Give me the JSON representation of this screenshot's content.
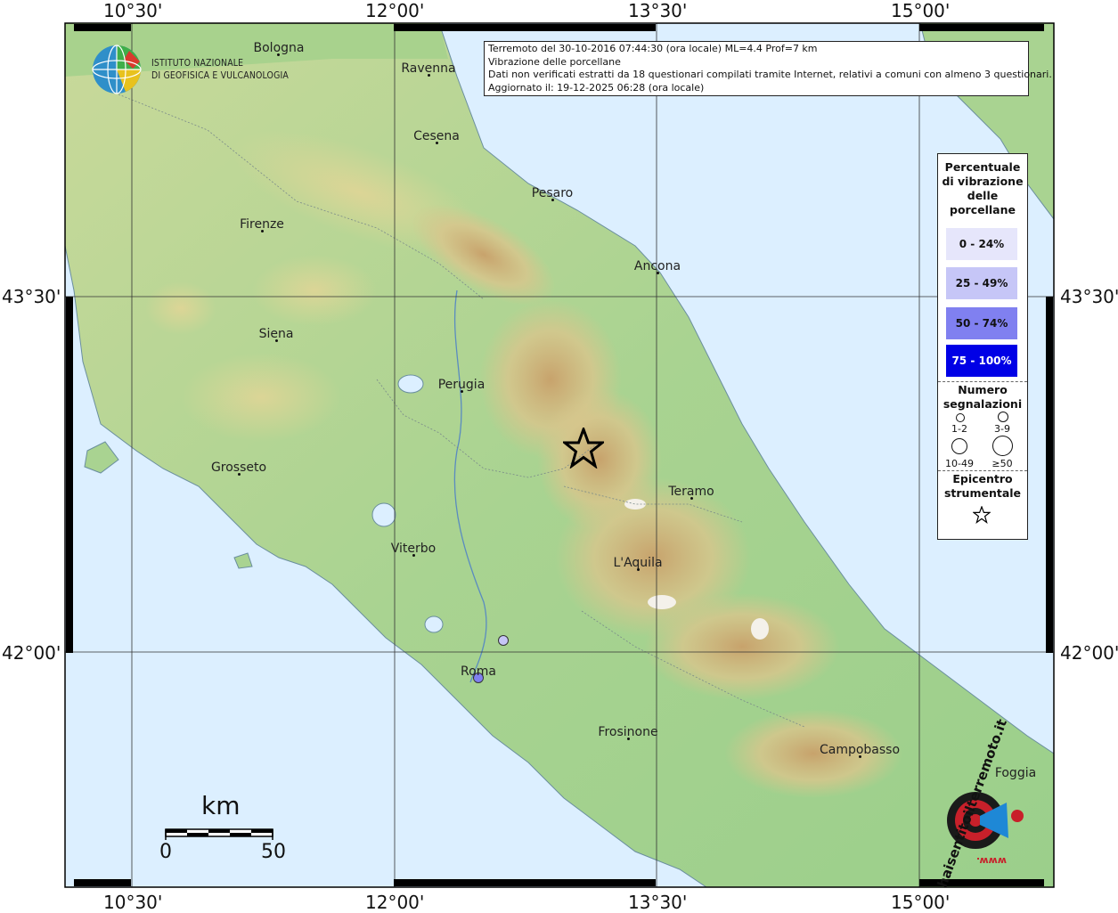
{
  "map": {
    "longitude_labels": [
      "10°30'",
      "12°00'",
      "13°30'",
      "15°00'"
    ],
    "latitude_labels": [
      "43°30'",
      "42°00'"
    ],
    "colors": {
      "sea": "#dcefff",
      "lowland": "#9fcf8c",
      "hills": "#d9c98c",
      "mountains": "#b5875a",
      "grid": "#333333",
      "frame": "#000000"
    },
    "cities": [
      {
        "name": "Bologna"
      },
      {
        "name": "Ravenna"
      },
      {
        "name": "Cesena"
      },
      {
        "name": "Pesaro"
      },
      {
        "name": "Firenze"
      },
      {
        "name": "Ancona"
      },
      {
        "name": "Siena"
      },
      {
        "name": "Perugia"
      },
      {
        "name": "Grosseto"
      },
      {
        "name": "Teramo"
      },
      {
        "name": "Viterbo"
      },
      {
        "name": "L'Aquila"
      },
      {
        "name": "Roma"
      },
      {
        "name": "Frosinone"
      },
      {
        "name": "Campobasso"
      },
      {
        "name": "Foggia"
      }
    ],
    "epicenter_icon": "star-icon",
    "reports": [
      {
        "place": "Roma area (north-east)",
        "percent_class": "0 - 24%",
        "count_class": "1-2"
      },
      {
        "place": "Roma",
        "percent_class": "25 - 49%",
        "count_class": "1-2"
      }
    ]
  },
  "institute": {
    "line1": "ISTITUTO NAZIONALE",
    "line2": "DI GEOFISICA E VULCANOLOGIA",
    "logo_icon": "ingv-globe-logo"
  },
  "info": {
    "line1": "Terremoto del 30-10-2016 07:44:30 (ora locale) ML=4.4 Prof=7 km",
    "line2": "Vibrazione delle porcellane",
    "line3": "Dati non verificati estratti da 18 questionari compilati tramite Internet, relativi a comuni con almeno 3 questionari.",
    "line4": "Aggiornato il: 19-12-2025 06:28 (ora locale)"
  },
  "legend": {
    "title": [
      "Percentuale",
      "di vibrazione",
      "delle",
      "porcellane"
    ],
    "classes": [
      {
        "label": "0 - 24%",
        "color": "#e6e6fb",
        "text_color": "#111111"
      },
      {
        "label": "25 - 49%",
        "color": "#c6c6f7",
        "text_color": "#111111"
      },
      {
        "label": "50 - 74%",
        "color": "#8080f0",
        "text_color": "#111111"
      },
      {
        "label": "75 - 100%",
        "color": "#0000e6",
        "text_color": "#ffffff"
      }
    ],
    "count_title": [
      "Numero",
      "segnalazioni"
    ],
    "counts": [
      "1-2",
      "3-9",
      "10-49",
      "≥50"
    ],
    "epicenter_title": [
      "Epicentro",
      "strumentale"
    ]
  },
  "scale": {
    "unit": "km",
    "min": "0",
    "max": "50"
  },
  "badge": {
    "text": "haisentitoilterremoto.it",
    "url_text": "www.",
    "icon": "megaphone-target-icon"
  }
}
